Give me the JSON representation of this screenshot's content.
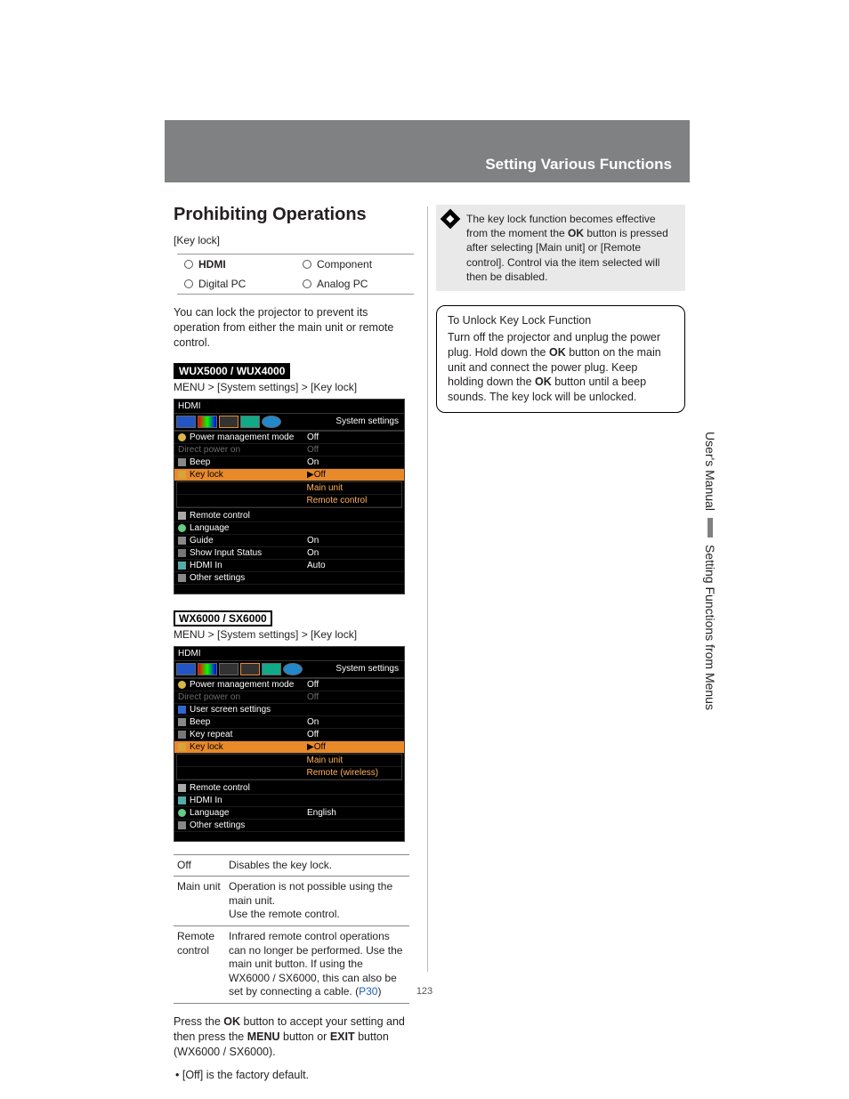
{
  "header": {
    "title": "Setting Various Functions"
  },
  "section": {
    "heading": "Prohibiting Operations",
    "subtitle": "[Key lock]",
    "inputs": [
      "HDMI",
      "Component",
      "Digital PC",
      "Analog PC"
    ],
    "intro": "You can lock the projector to prevent its operation from either the main unit or remote control.",
    "model1_badge": "WUX5000 / WUX4000",
    "model1_path": "MENU > [System settings] > [Key lock]",
    "model2_badge": "WX6000 / SX6000",
    "model2_path": "MENU > [System settings] > [Key lock]",
    "press_note_pre": "Press the ",
    "press_note_ok": "OK",
    "press_note_mid": " button to accept your setting and then press the ",
    "press_note_menu": "MENU",
    "press_note_or": " button or ",
    "press_note_exit": "EXIT",
    "press_note_end": " button (WX6000 / SX6000).",
    "bullet": "[Off] is the factory default."
  },
  "osd1": {
    "title_left": "HDMI",
    "tabs_label": "System settings",
    "rows": [
      {
        "label": "Power management mode",
        "value": "Off",
        "icon": "ic-bulb"
      },
      {
        "label": "Direct power on",
        "value": "Off",
        "dim": true
      },
      {
        "label": "Beep",
        "value": "On",
        "icon": "ic-beep"
      },
      {
        "label": "Key lock",
        "value": "▶Off",
        "hl": true,
        "icon": "ic-key"
      },
      {
        "label": "",
        "value": "Main unit",
        "sub": true
      },
      {
        "label": "",
        "value": "Remote control",
        "sub": true,
        "orange": true
      },
      {
        "label": "Remote control",
        "value": "",
        "icon": "ic-remote"
      },
      {
        "label": "Language",
        "value": "",
        "icon": "ic-lang"
      },
      {
        "label": "Guide",
        "value": "On",
        "icon": "ic-guide"
      },
      {
        "label": "Show Input Status",
        "value": "On",
        "icon": "ic-show"
      },
      {
        "label": "HDMI In",
        "value": "Auto",
        "icon": "ic-hdmi"
      },
      {
        "label": "Other settings",
        "value": "",
        "icon": "ic-other"
      }
    ]
  },
  "osd2": {
    "title_left": "HDMI",
    "tabs_label": "System settings",
    "rows": [
      {
        "label": "Power management mode",
        "value": "Off",
        "icon": "ic-bulb"
      },
      {
        "label": "Direct power on",
        "value": "Off",
        "dim": true
      },
      {
        "label": "User screen settings",
        "value": "",
        "icon": "ic-user"
      },
      {
        "label": "Beep",
        "value": "On",
        "icon": "ic-beep"
      },
      {
        "label": "Key repeat",
        "value": "Off",
        "icon": "ic-repeat"
      },
      {
        "label": "Key lock",
        "value": "▶Off",
        "hl": true,
        "icon": "ic-key"
      },
      {
        "label": "",
        "value": "Main unit",
        "sub": true
      },
      {
        "label": "",
        "value": "Remote (wireless)",
        "sub": true,
        "orange": true
      },
      {
        "label": "Remote control",
        "value": "",
        "icon": "ic-remote"
      },
      {
        "label": "HDMI In",
        "value": "",
        "icon": "ic-hdmi"
      },
      {
        "label": "Language",
        "value": "English",
        "icon": "ic-lang"
      },
      {
        "label": "Other settings",
        "value": "",
        "icon": "ic-other"
      }
    ]
  },
  "options_table": [
    {
      "name": "Off",
      "desc": "Disables the key lock."
    },
    {
      "name": "Main unit",
      "desc": "Operation is not possible using the main unit.\nUse the remote control."
    },
    {
      "name": "Remote control",
      "desc_pre": "Infrared remote control operations can no longer be performed. Use the main unit button. If using the WX6000 / SX6000, this can also be set by connecting a cable. (",
      "link": "P30",
      "desc_post": ")"
    }
  ],
  "note": {
    "text_pre": "The key lock function becomes effective from the moment the ",
    "ok": "OK",
    "text_post": " button is pressed after selecting [Main unit] or [Remote control]. Control via the item selected will then be disabled."
  },
  "unlock_box": {
    "title": "To Unlock Key Lock Function",
    "body_pre": "Turn off the projector and unplug the power plug. Hold down the ",
    "ok1": "OK",
    "body_mid": " button on the main unit and connect the power plug. Keep holding down the ",
    "ok2": "OK",
    "body_post": " button until a beep sounds. The key lock will be unlocked."
  },
  "side": {
    "top": "User's Manual",
    "bottom": "Setting Functions from Menus"
  },
  "page_number": "123"
}
